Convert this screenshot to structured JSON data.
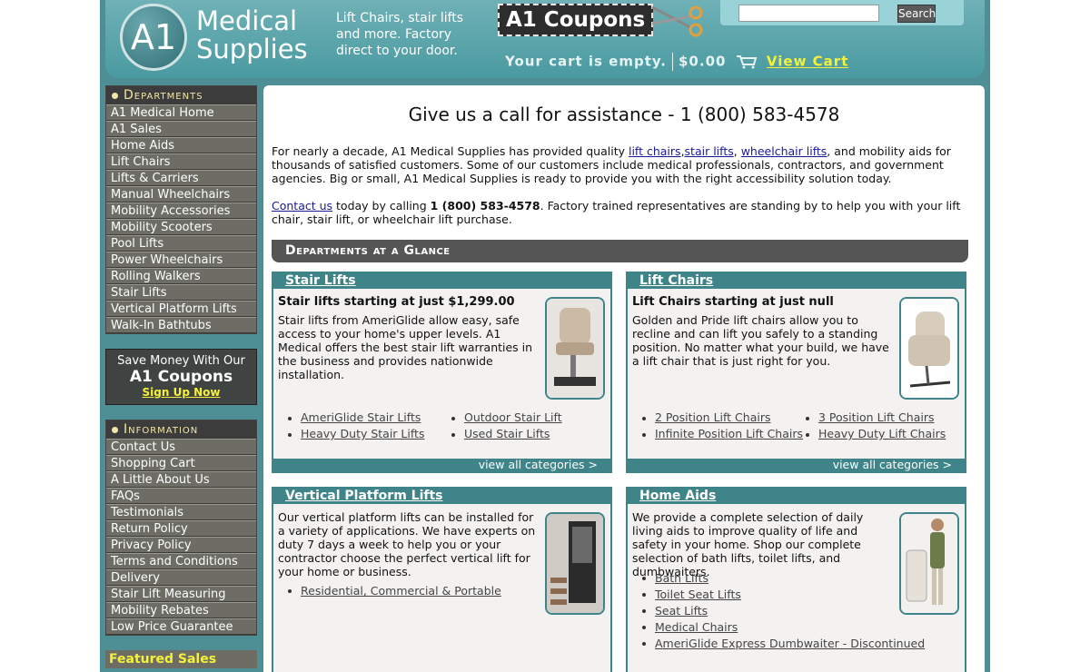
{
  "header": {
    "logo_mark": "A1",
    "logo_line1": "Medical",
    "logo_line2": "Supplies",
    "tagline": "Lift Chairs, stair lifts and more. Factory direct to your door.",
    "coupon_badge": "A1 Coupons",
    "search_button": "Search",
    "search_value": "",
    "cart_status": "Your cart is empty.",
    "cart_total": "$0.00",
    "view_cart": "View Cart"
  },
  "departments": {
    "title": "Departments",
    "items": [
      "A1 Medical Home",
      "A1 Sales",
      "Home Aids",
      "Lift Chairs",
      "Lifts & Carriers",
      "Manual Wheelchairs",
      "Mobility Accessories",
      "Mobility Scooters",
      "Pool Lifts",
      "Power Wheelchairs",
      "Rolling Walkers",
      "Stair Lifts",
      "Vertical Platform Lifts",
      "Walk-In Bathtubs"
    ]
  },
  "save_box": {
    "line1": "Save Money With Our",
    "line2": "A1 Coupons",
    "line3": "Sign Up Now"
  },
  "information": {
    "title": "Information",
    "items": [
      "Contact Us",
      "Shopping Cart",
      "A Little About Us",
      "FAQs",
      "Testimonials",
      "Return Policy",
      "Privacy Policy",
      "Terms and Conditions",
      "Delivery",
      "Stair Lift Measuring",
      "Mobility Rebates",
      "Low Price Guarantee"
    ]
  },
  "featured": "Featured Sales",
  "main": {
    "phone_title": "Give us a call for assistance - 1 (800) 583-4578",
    "intro_pre": "For nearly a decade, A1 Medical Supplies has provided quality ",
    "intro_link1": "lift chairs",
    "intro_comma": ",",
    "intro_link2": "stair lifts",
    "intro_comma2": ", ",
    "intro_link3": "wheelchair lifts",
    "intro_post": ", and mobility aids for thousands of satisfied customers. Some of our customers include medical professionals, contractors, and government agencies. Big or small, A1 Medical Supplies is ready to provide you with the right accessibility solution today.",
    "contact_link": "Contact us",
    "contact_mid": " today by calling ",
    "contact_phone": "1 (800) 583-4578",
    "contact_post": ". Factory trained representatives are standing by to help you with your lift chair, stair lift, or wheelchair lift purchase.",
    "glance_title": "Departments at a Glance"
  },
  "cards": {
    "stair": {
      "title": "Stair Lifts",
      "sub": "Stair lifts starting at just $1,299.00",
      "desc": "Stair lifts from AmeriGlide allow easy, safe access to your home's upper levels. A1 Medical offers the best stair lift warranties in the business and provides nationwide installation.",
      "links": [
        "AmeriGlide Stair Lifts",
        "Heavy Duty Stair Lifts",
        "Outdoor Stair Lift",
        "Used Stair Lifts"
      ],
      "foot": "view all categories >"
    },
    "lift": {
      "title": "Lift Chairs",
      "sub": "Lift Chairs starting at just null",
      "desc": "Golden and Pride lift chairs allow you to recline and can lift you safely to a standing position. No matter what your build, we have a lift chair that is just right for you.",
      "links": [
        "2 Position Lift Chairs",
        "Infinite Position Lift Chairs",
        "3 Position Lift Chairs",
        "Heavy Duty Lift Chairs"
      ],
      "foot": "view all categories >"
    },
    "vpl": {
      "title": "Vertical Platform Lifts",
      "desc": "Our vertical platform lifts can be installed for a variety of applications. We have experts on duty 7 days a week to help you or your contractor choose the perfect vertical lift for your home or business.",
      "links": [
        "Residential, Commercial & Portable"
      ]
    },
    "home": {
      "title": "Home Aids",
      "desc": "We provide a complete selection of daily living aids to improve quality of life and safety in your home. Shop our complete selection of bath lifts, toilet lifts, and dumbwaiters.",
      "links": [
        "Bath Lifts",
        "Toilet Seat Lifts",
        "Seat Lifts",
        "Medical Chairs",
        "AmeriGlide Express Dumbwaiter - Discontinued"
      ]
    }
  }
}
